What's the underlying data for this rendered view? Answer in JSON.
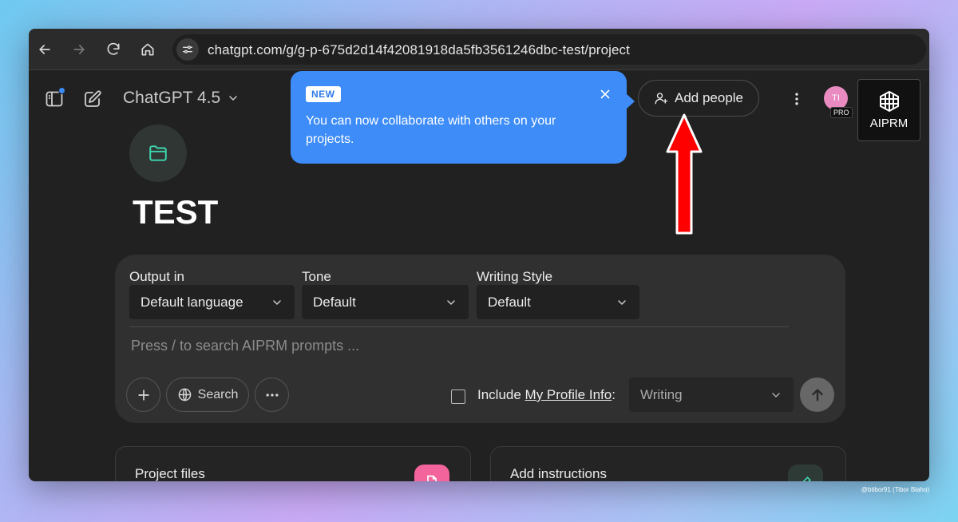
{
  "browser": {
    "url": "chatgpt.com/g/g-p-675d2d14f42081918da5fb3561246dbc-test/project",
    "icons": [
      "back-icon",
      "forward-icon",
      "reload-icon",
      "home-icon",
      "site-settings-icon"
    ]
  },
  "header": {
    "model_name": "ChatGPT 4.5",
    "add_people_label": "Add people",
    "avatar_initials": "TI",
    "pro_badge": "PRO",
    "aiprm_label": "AIPRM"
  },
  "popover": {
    "badge": "NEW",
    "message": "You can now collaborate with others on your projects."
  },
  "project": {
    "title": "TEST"
  },
  "composer": {
    "output_label": "Output in",
    "output_value": "Default language",
    "tone_label": "Tone",
    "tone_value": "Default",
    "style_label": "Writing Style",
    "style_value": "Default",
    "prompt_placeholder": "Press / to search AIPRM prompts ...",
    "search_label": "Search",
    "include_prefix": "Include ",
    "include_link": "My Profile Info",
    "include_suffix": ":",
    "writing_value": "Writing"
  },
  "cards": {
    "files_title": "Project files",
    "instructions_title": "Add instructions"
  },
  "colors": {
    "accent_blue": "#3d8cf7",
    "annotation_red": "#ff0000",
    "folder_teal": "#3fd7b0",
    "file_pink": "#f2649b"
  },
  "watermark": "@btibor91 (Tibor Blaho)"
}
